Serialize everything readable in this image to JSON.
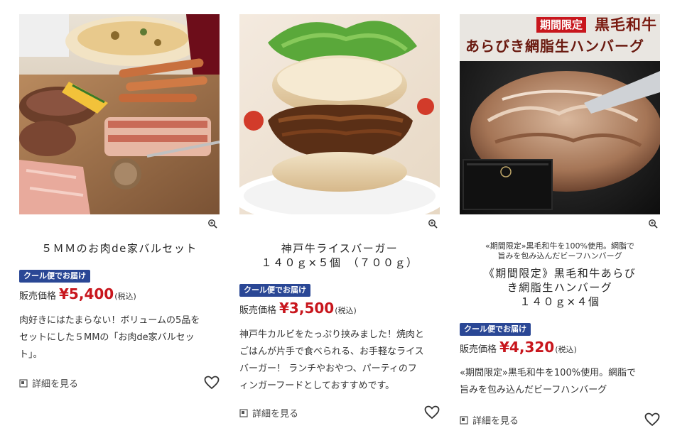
{
  "colors": {
    "badge_bg": "#2a4795",
    "price": "#c8161d",
    "banner_red": "#c8161d"
  },
  "products": [
    {
      "title_lines": [
        "５ＭＭのお肉de家バルセット"
      ],
      "badge": "クール便でお届け",
      "price_label": "販売価格",
      "price": "¥5,400",
      "tax": "(税込)",
      "desc_lines": [
        "肉好きにはたまらない！ボリュームの5品を",
        "セットにした５MMの「お肉de家バルセッ",
        "ト」。"
      ],
      "detail_label": "詳細を見る",
      "image_icon": "product-photo-meat-platter",
      "zoom_icon": "zoom-icon",
      "fav_icon": "heart-icon"
    },
    {
      "title_lines": [
        "神戸牛ライスバーガー",
        "１４０ｇ×５個　（７００ｇ）"
      ],
      "badge": "クール便でお届け",
      "price_label": "販売価格",
      "price": "¥3,500",
      "tax": "(税込)",
      "desc_lines": [
        "神戸牛カルビをたっぷり挟みました！焼肉と",
        "ごはんが片手で食べられる、お手軽なライス",
        "バーガー！ ランチやおやつ、パーティのフ",
        "ィンガーフードとしておすすめです。"
      ],
      "detail_label": "詳細を見る",
      "image_icon": "product-photo-rice-burger",
      "zoom_icon": "zoom-icon",
      "fav_icon": "heart-icon"
    },
    {
      "catch_lines": [
        "«期間限定»黒毛和牛を100%使用。網脂で",
        "旨みを包み込んだビーフハンバーグ"
      ],
      "title_lines": [
        "《期間限定》黒毛和牛あらび",
        "き網脂生ハンバーグ",
        "１４０ｇ×４個"
      ],
      "badge": "クール便でお届け",
      "price_label": "販売価格",
      "price": "¥4,320",
      "tax": "(税込)",
      "desc_lines": [
        "«期間限定»黒毛和牛を100%使用。網脂で",
        "旨みを包み込んだビーフハンバーグ"
      ],
      "detail_label": "詳細を見る",
      "banner_tag": "期間限定",
      "banner_brand": "黒毛和牛",
      "banner_title": "あらびき網脂生ハンバーグ",
      "image_icon": "product-photo-hamburg-steak",
      "zoom_icon": "zoom-icon",
      "fav_icon": "heart-icon"
    }
  ]
}
